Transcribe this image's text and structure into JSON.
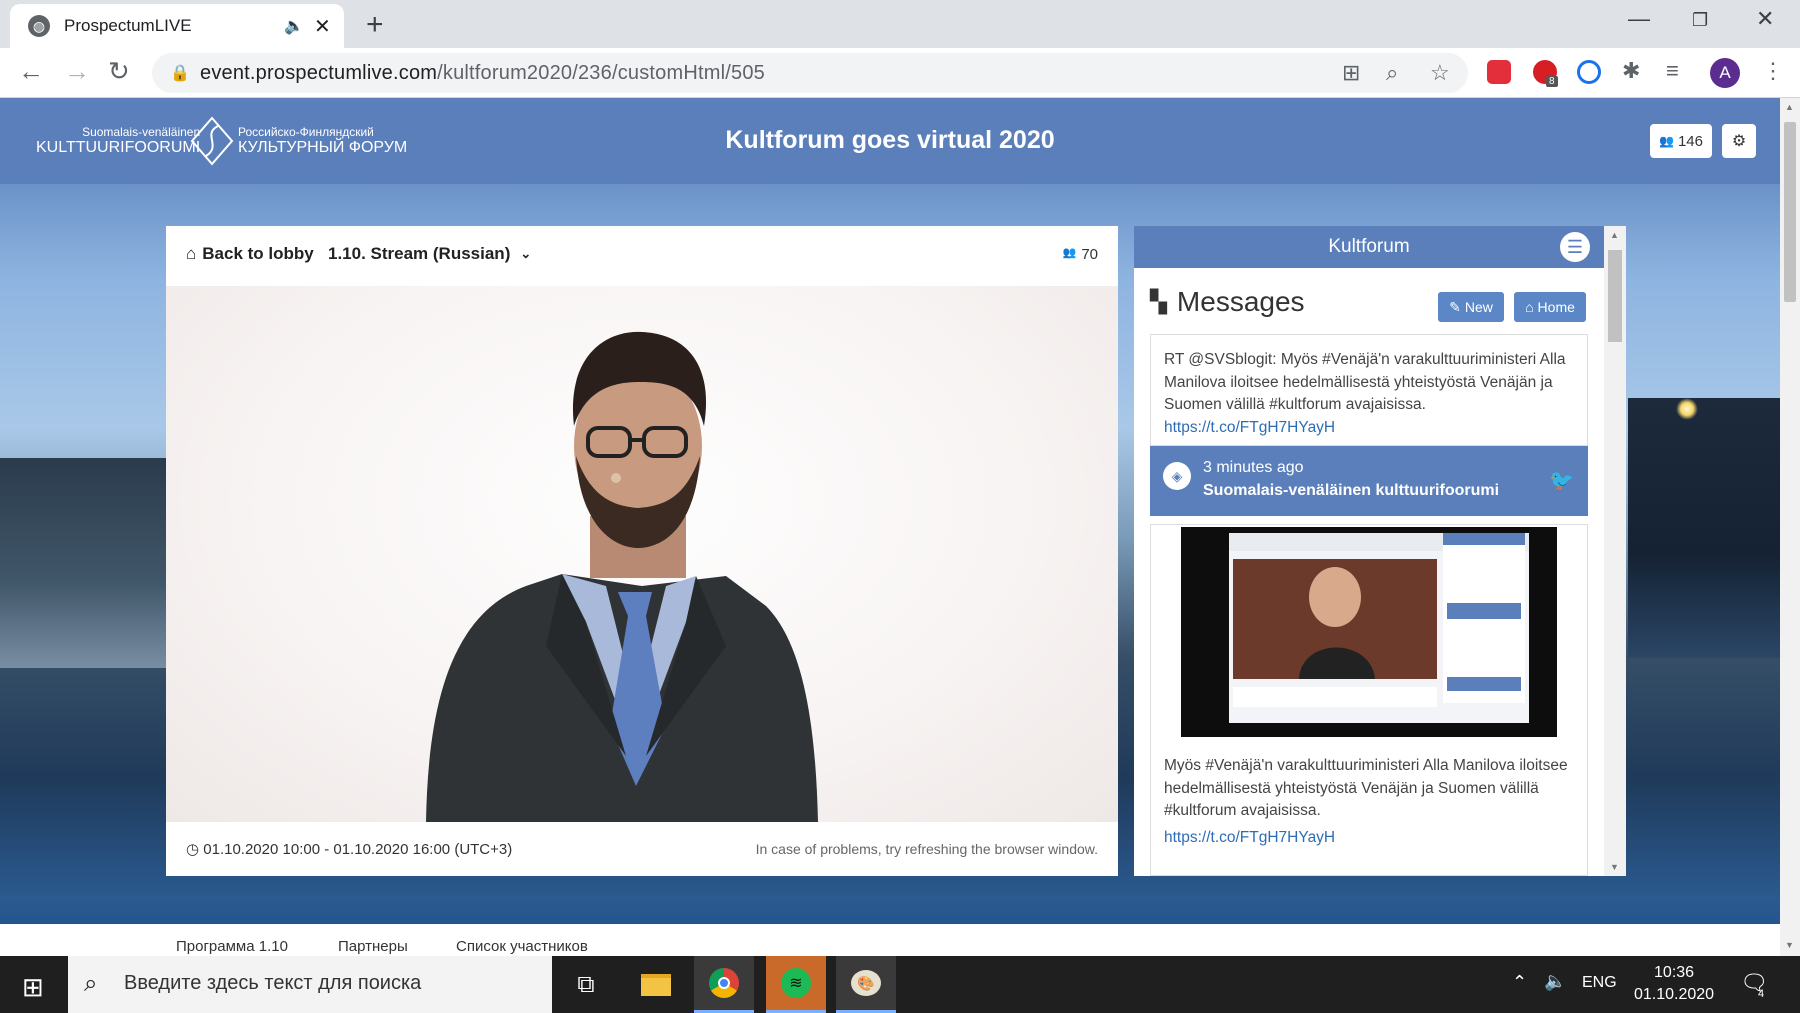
{
  "browser": {
    "tab_title": "ProspectumLIVE",
    "url_host": "event.prospectumlive.com",
    "url_path": "/kultforum2020/236/customHtml/505",
    "badge_count": "8",
    "avatar_letter": "A"
  },
  "header": {
    "logo_fi_small": "Suomalais-venäläinen",
    "logo_fi_big": "KULTTUURIFOORUMI",
    "logo_ru_small": "Российско-Финляндский",
    "logo_ru_big": "КУЛЬТУРНЫЙ ФОРУМ",
    "title": "Kultforum goes virtual 2020",
    "viewers": "146"
  },
  "stream": {
    "back_label": "Back to lobby",
    "stream_name": "1.10. Stream (Russian)",
    "viewer_count": "70",
    "time_range": "01.10.2020 10:00 - 01.10.2020 16:00 (UTC+3)",
    "problem_note": "In case of problems, try refreshing the browser window."
  },
  "chat": {
    "header": "Kultforum",
    "messages_title": "Messages",
    "new_label": "New",
    "home_label": "Home",
    "posts": [
      {
        "text": "RT @SVSblogit: Myös #Venäjä'n varakulttuuriministeri Alla Manilova iloitsee hedelmällisestä yhteistyöstä Venäjän ja Suomen välillä #kultforum avajaisissa.",
        "link": "https://t.co/FTgH7HYayH",
        "time": "3 minutes ago",
        "author": "Suomalais-venäläinen kulttuurifoorumi"
      },
      {
        "text": "Myös #Venäjä'n varakulttuuriministeri Alla Manilova iloitsee hedelmällisestä yhteistyöstä Venäjän ja Suomen välillä #kultforum avajaisissa.",
        "link": "https://t.co/FTgH7HYayH"
      }
    ]
  },
  "bottom_menu": [
    "Программа 1.10",
    "Партнеры",
    "Список участников"
  ],
  "taskbar": {
    "search_placeholder": "Введите здесь текст для поиска",
    "lang": "ENG",
    "time": "10:36",
    "date": "01.10.2020",
    "notif_count": "4"
  },
  "colors": {
    "header": "#5b7fbb",
    "button": "#5b87c7",
    "link": "#2d6db5"
  }
}
